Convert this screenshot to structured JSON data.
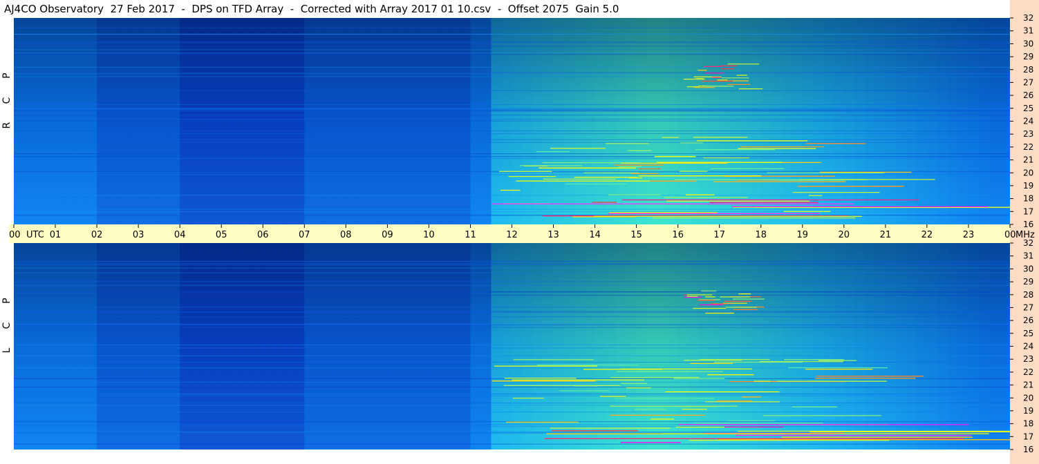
{
  "title": "AJ4CO Observatory  27 Feb 2017  -  DPS on TFD Array  -  Corrected with Array 2017 01 10.csv  -  Offset 2075  Gain 5.0",
  "colors": {
    "background": "#ffffff",
    "time_axis_band": "#ffffc4",
    "freq_axis_band": "#fcdcc4",
    "colormap": [
      "#000010",
      "#001a6e",
      "#0838c8",
      "#0a78f0",
      "#1ab4f0",
      "#3ce6c8",
      "#b4f050",
      "#ffff00",
      "#ff3c3c",
      "#ff00ff",
      "#ffffff"
    ]
  },
  "chart_data": [
    {
      "type": "heatmap",
      "panel": "top",
      "polarization_label": [
        "R",
        "C",
        "P"
      ],
      "x_axis": {
        "unit_label": "UTC",
        "tick_labels": [
          "00",
          "01",
          "02",
          "03",
          "04",
          "05",
          "06",
          "07",
          "08",
          "09",
          "10",
          "11",
          "12",
          "13",
          "14",
          "15",
          "16",
          "17",
          "18",
          "19",
          "20",
          "21",
          "22",
          "23",
          "00"
        ],
        "range_hours": [
          0,
          24
        ]
      },
      "y_axis": {
        "unit_label": "MHz",
        "tick_labels": [
          "32",
          "31",
          "30",
          "29",
          "28",
          "27",
          "26",
          "25",
          "24",
          "23",
          "22",
          "21",
          "20",
          "19",
          "18",
          "17",
          "16"
        ],
        "range_mhz": [
          16,
          32
        ],
        "position": "right"
      },
      "features": {
        "background_brightening_hours": [
          11.5,
          24
        ],
        "peak_brightening_hour": 15.5,
        "dark_period_hours": [
          4,
          7
        ],
        "bright_band_mhz": [
          16.5,
          17.8
        ],
        "interference_cluster_hours": [
          16,
          17.5
        ],
        "interference_cluster_mhz": [
          26.5,
          28.5
        ]
      }
    },
    {
      "type": "heatmap",
      "panel": "bottom",
      "polarization_label": [
        "L",
        "C",
        "P"
      ],
      "x_axis": {
        "tick_labels": [
          "00",
          "01",
          "02",
          "03",
          "04",
          "05",
          "06",
          "07",
          "08",
          "09",
          "10",
          "11",
          "12",
          "13",
          "14",
          "15",
          "16",
          "17",
          "18",
          "19",
          "20",
          "21",
          "22",
          "23",
          "00"
        ],
        "range_hours": [
          0,
          24
        ]
      },
      "y_axis": {
        "tick_labels": [
          "32",
          "31",
          "30",
          "29",
          "28",
          "27",
          "26",
          "25",
          "24",
          "23",
          "22",
          "21",
          "20",
          "19",
          "18",
          "17",
          "16"
        ],
        "range_mhz": [
          16,
          32
        ],
        "position": "right"
      },
      "features": {
        "background_brightening_hours": [
          11.5,
          24
        ],
        "peak_brightening_hour": 15.5,
        "dark_period_hours": [
          4,
          7
        ],
        "bright_band_mhz": [
          16.5,
          17.8
        ],
        "interference_cluster_hours": [
          16,
          17.5
        ],
        "interference_cluster_mhz": [
          26.5,
          28.5
        ]
      }
    }
  ]
}
